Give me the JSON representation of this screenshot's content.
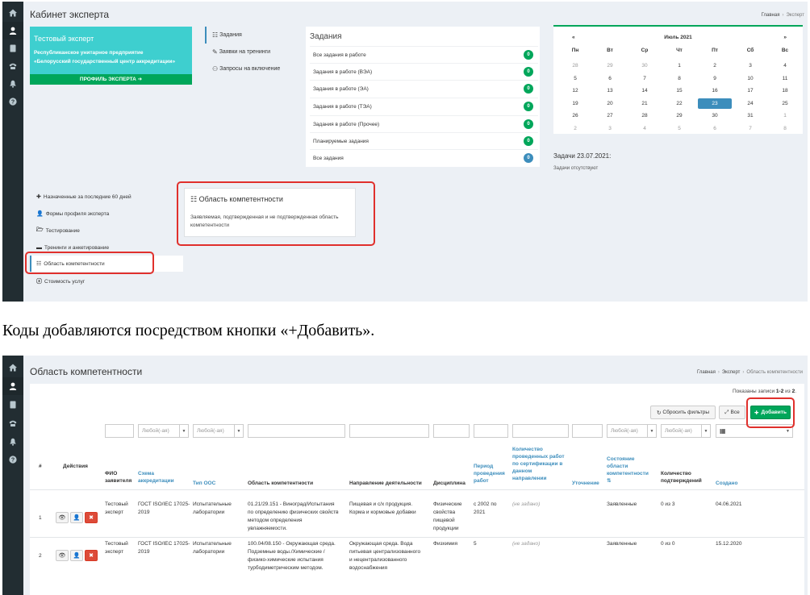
{
  "colors": {
    "sidebar": "#222d32",
    "accent": "#3c8dbc",
    "success": "#00a65a",
    "teal": "#3ecfcf",
    "danger": "#dd4b39",
    "highlight": "#e0302c"
  },
  "screen1": {
    "title": "Кабинет эксперта",
    "breadcrumb": {
      "home": "Главная",
      "current": "Эксперт"
    },
    "expert": {
      "name": "Тестовый эксперт",
      "org_line1": "Республиканское унитарное предприятие",
      "org_line2": "«Белорусский государственный центр аккредитации»",
      "profile_button": "ПРОФИЛЬ ЭКСПЕРТА ➜"
    },
    "menu_top": [
      {
        "label": "Задания",
        "icon": "list-icon"
      },
      {
        "label": "Заявки на тренинги",
        "icon": "pin-icon"
      },
      {
        "label": "Запросы на включение",
        "icon": "user-plus-icon"
      }
    ],
    "tasks": {
      "title": "Задания",
      "rows": [
        {
          "label": "Все задания в работе",
          "count": "0",
          "color": "#00a65a"
        },
        {
          "label": "Задания в работе (ВЭА)",
          "count": "0",
          "color": "#00a65a"
        },
        {
          "label": "Задания в работе (ЭА)",
          "count": "0",
          "color": "#00a65a"
        },
        {
          "label": "Задания в работе (ТЭА)",
          "count": "0",
          "color": "#00a65a"
        },
        {
          "label": "Задания в работе (Прочее)",
          "count": "0",
          "color": "#00a65a"
        },
        {
          "label": "Планируемые задания",
          "count": "0",
          "color": "#00a65a"
        },
        {
          "label": "Все задания",
          "count": "0",
          "color": "#3c8dbc"
        }
      ]
    },
    "calendar": {
      "prev": "«",
      "next": "»",
      "month": "Июль 2021",
      "day_names": [
        "Пн",
        "Вт",
        "Ср",
        "Чт",
        "Пт",
        "Сб",
        "Вс"
      ],
      "weeks": [
        [
          "28",
          "29",
          "30",
          "1",
          "2",
          "3",
          "4"
        ],
        [
          "5",
          "6",
          "7",
          "8",
          "9",
          "10",
          "11"
        ],
        [
          "12",
          "13",
          "14",
          "15",
          "16",
          "17",
          "18"
        ],
        [
          "19",
          "20",
          "21",
          "22",
          "23",
          "24",
          "25"
        ],
        [
          "26",
          "27",
          "28",
          "29",
          "30",
          "31",
          "1"
        ],
        [
          "2",
          "3",
          "4",
          "5",
          "6",
          "7",
          "8"
        ]
      ],
      "today": "23"
    },
    "day_tasks_title": "Задачи 23.07.2021:",
    "day_tasks_empty": "Задачи отсутствуют",
    "menu_bottom": [
      {
        "label": "Назначенные за последние 60 дней",
        "icon": "plus-icon",
        "glyph": "✚"
      },
      {
        "label": "Формы профиля эксперта",
        "icon": "user-icon",
        "glyph": "👤"
      },
      {
        "label": "Тестирование",
        "icon": "folder-icon",
        "glyph": "🗁"
      },
      {
        "label": "Тренинги и анкетирование",
        "icon": "tasks-icon",
        "glyph": "▬"
      },
      {
        "label": "Область компетентности",
        "icon": "list-alt-icon",
        "glyph": "☷"
      },
      {
        "label": "Стоимость услуг",
        "icon": "coin-icon",
        "glyph": "ⓢ"
      }
    ],
    "competence_card": {
      "title": "Область компетентности",
      "description": "Заявляемая, подтвержденная и не подтвержденная область компетентности"
    }
  },
  "instruction_text": "Коды добавляются посредством кнопки «+Добавить».",
  "screen2": {
    "title": "Область компетентности",
    "breadcrumb": {
      "home": "Главная",
      "middle": "Эксперт",
      "current": "Область компетентности"
    },
    "shown": {
      "prefix": "Показаны записи ",
      "range": "1-2",
      "mid": " из ",
      "total": "2",
      "suffix": "."
    },
    "buttons": {
      "reset": "Сбросить фильтры",
      "all": "Все",
      "add": "Добавить"
    },
    "filters": {
      "any": "Любой(-ая)"
    },
    "columns": {
      "num": "#",
      "actions": "Действия",
      "applicant": [
        "ФИО",
        "заявителя"
      ],
      "scheme": [
        "Схема",
        "аккредитации"
      ],
      "type": "Тип ООС",
      "area": "Область компетентности",
      "direction": "Направление деятельности",
      "discipline": "Дисциплина",
      "period": [
        "Период",
        "проведения",
        "работ"
      ],
      "count": [
        "Количество",
        "проведенных работ",
        "по сертификации в",
        "данном",
        "направлении"
      ],
      "clarification": "Уточнение",
      "state": [
        "Состояние",
        "области",
        "компетентности"
      ],
      "confirm": [
        "Количество",
        "подтверждений"
      ],
      "created": "Создано"
    },
    "rows": [
      {
        "num": "1",
        "applicant": [
          "Тестовый",
          "эксперт"
        ],
        "scheme": [
          "ГОСТ ISO/IEC 17025-",
          "2019"
        ],
        "type": [
          "Испытательные",
          "лаборатории"
        ],
        "area": [
          "01.21/29.151 - Виноград/Испытания",
          "по определению физических свойств",
          "методом определения",
          "увлажняемости."
        ],
        "direction": [
          "Пищевая и с/х продукция.",
          "Корма и кормовые добавки"
        ],
        "discipline": [
          "Физические",
          "свойства",
          "пищевой",
          "продукции"
        ],
        "period": [
          "с 2002 по",
          "2021"
        ],
        "count": "(не задано)",
        "state": "Заявленные",
        "confirm": "0 из 3",
        "created": "04.06.2021"
      },
      {
        "num": "2",
        "applicant": [
          "Тестовый",
          "эксперт"
        ],
        "scheme": [
          "ГОСТ ISO/IEC 17025-",
          "2019"
        ],
        "type": [
          "Испытательные",
          "лаборатории"
        ],
        "area": [
          "100.04/08.150 - Окружающая среда.",
          "Подземные воды./Химические /",
          "физико-химические испытания",
          "турбодиметрическим методом."
        ],
        "direction": [
          "Окружающая среда. Вода",
          "питьевая централизованного",
          "и нецентрализованного",
          "водоснабжения"
        ],
        "discipline": [
          "Физхимия"
        ],
        "period": [
          "5"
        ],
        "count": "(не задано)",
        "state": "Заявленные",
        "confirm": "0 из 0",
        "created": "15.12.2020"
      }
    ]
  }
}
